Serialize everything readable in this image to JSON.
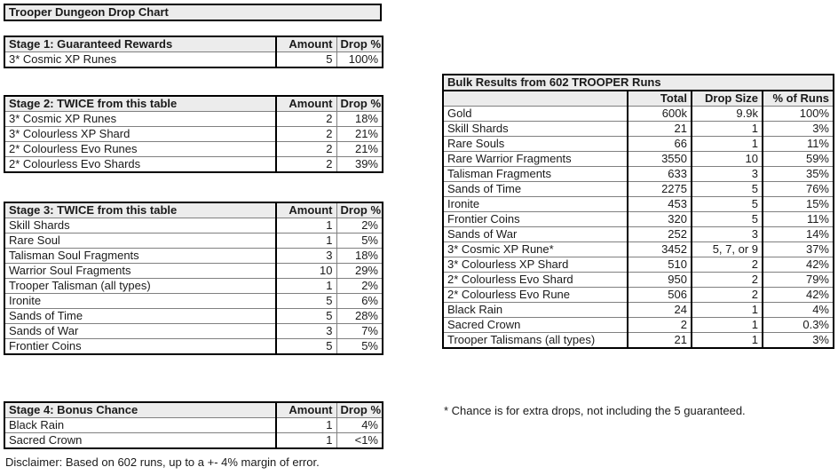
{
  "title": "Trooper Dungeon Drop Chart",
  "left": {
    "columns": [
      "Amount",
      "Drop %"
    ],
    "stages": [
      {
        "header": "Stage 1: Guaranteed Rewards",
        "rows": [
          {
            "name": "3* Cosmic XP Runes",
            "amount": "5",
            "drop": "100%"
          }
        ]
      },
      {
        "header": "Stage 2: TWICE from this table",
        "rows": [
          {
            "name": "3* Cosmic XP Runes",
            "amount": "2",
            "drop": "18%"
          },
          {
            "name": "3* Colourless XP Shard",
            "amount": "2",
            "drop": "21%"
          },
          {
            "name": "2* Colourless Evo Runes",
            "amount": "2",
            "drop": "21%"
          },
          {
            "name": "2* Colourless Evo Shards",
            "amount": "2",
            "drop": "39%"
          }
        ]
      },
      {
        "header": "Stage 3: TWICE from this table",
        "rows": [
          {
            "name": "Skill Shards",
            "amount": "1",
            "drop": "2%"
          },
          {
            "name": "Rare Soul",
            "amount": "1",
            "drop": "5%"
          },
          {
            "name": "Talisman Soul Fragments",
            "amount": "3",
            "drop": "18%"
          },
          {
            "name": "Warrior Soul Fragments",
            "amount": "10",
            "drop": "29%"
          },
          {
            "name": "Trooper Talisman (all types)",
            "amount": "1",
            "drop": "2%"
          },
          {
            "name": "Ironite",
            "amount": "5",
            "drop": "6%"
          },
          {
            "name": "Sands of Time",
            "amount": "5",
            "drop": "28%"
          },
          {
            "name": "Sands of War",
            "amount": "3",
            "drop": "7%"
          },
          {
            "name": "Frontier Coins",
            "amount": "5",
            "drop": "5%"
          }
        ]
      },
      {
        "header": "Stage 4: Bonus Chance",
        "rows": [
          {
            "name": "Black Rain",
            "amount": "1",
            "drop": "4%"
          },
          {
            "name": "Sacred Crown",
            "amount": "1",
            "drop": "<1%"
          }
        ]
      }
    ],
    "disclaimer": "Disclaimer: Based on 602 runs, up to a +- 4% margin of error."
  },
  "right": {
    "title": "Bulk Results from 602 TROOPER Runs",
    "columns": [
      "",
      "Total",
      "Drop Size",
      "% of Runs"
    ],
    "rows": [
      {
        "name": "Gold",
        "total": "600k",
        "size": "9.9k",
        "pct": "100%"
      },
      {
        "name": "Skill Shards",
        "total": "21",
        "size": "1",
        "pct": "3%"
      },
      {
        "name": "Rare Souls",
        "total": "66",
        "size": "1",
        "pct": "11%"
      },
      {
        "name": "Rare Warrior Fragments",
        "total": "3550",
        "size": "10",
        "pct": "59%"
      },
      {
        "name": "Talisman Fragments",
        "total": "633",
        "size": "3",
        "pct": "35%"
      },
      {
        "name": "Sands of Time",
        "total": "2275",
        "size": "5",
        "pct": "76%"
      },
      {
        "name": "Ironite",
        "total": "453",
        "size": "5",
        "pct": "15%"
      },
      {
        "name": "Frontier Coins",
        "total": "320",
        "size": "5",
        "pct": "11%"
      },
      {
        "name": "Sands of War",
        "total": "252",
        "size": "3",
        "pct": "14%"
      },
      {
        "name": "3* Cosmic XP Rune*",
        "total": "3452",
        "size": "5, 7, or 9",
        "pct": "37%"
      },
      {
        "name": "3* Colourless XP Shard",
        "total": "510",
        "size": "2",
        "pct": "42%"
      },
      {
        "name": "2* Colourless Evo Shard",
        "total": "950",
        "size": "2",
        "pct": "79%"
      },
      {
        "name": "2* Colourless Evo Rune",
        "total": "506",
        "size": "2",
        "pct": "42%"
      },
      {
        "name": "Black Rain",
        "total": "24",
        "size": "1",
        "pct": "4%"
      },
      {
        "name": "Sacred Crown",
        "total": "2",
        "size": "1",
        "pct": "0.3%"
      },
      {
        "name": "Trooper Talismans (all types)",
        "total": "21",
        "size": "1",
        "pct": "3%"
      }
    ],
    "footnote": "* Chance is for extra drops, not including the 5 guaranteed."
  },
  "colors": {
    "header_fill": "#ececec",
    "grid_line": "#808080",
    "outer_border": "#000000",
    "text": "#1a1a1a",
    "page_background": "#ffffff"
  }
}
